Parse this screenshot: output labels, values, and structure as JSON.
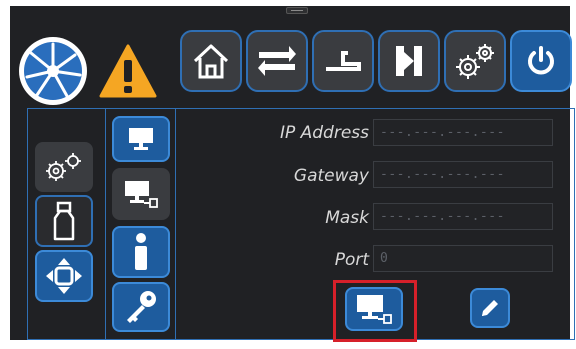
{
  "toolbar": {
    "buttons": [
      "home",
      "transfer",
      "bed-profile",
      "doorframe",
      "settings",
      "power"
    ]
  },
  "side_tabs": [
    "settings",
    "weight",
    "movement"
  ],
  "sub_tabs": [
    "monitor",
    "network-monitor",
    "info",
    "key"
  ],
  "network": {
    "ip_label": "IP Address",
    "ip_value": "---.---.---.---",
    "gateway_label": "Gateway",
    "gateway_value": "---.---.---.---",
    "mask_label": "Mask",
    "mask_value": "---.---.---.---",
    "port_label": "Port",
    "port_value": "0"
  },
  "colors": {
    "background": "#202124",
    "accent_blue": "#1e5c9e",
    "border_blue": "#2f6fb4",
    "warning": "#f5a623",
    "highlight": "#d6202a"
  }
}
